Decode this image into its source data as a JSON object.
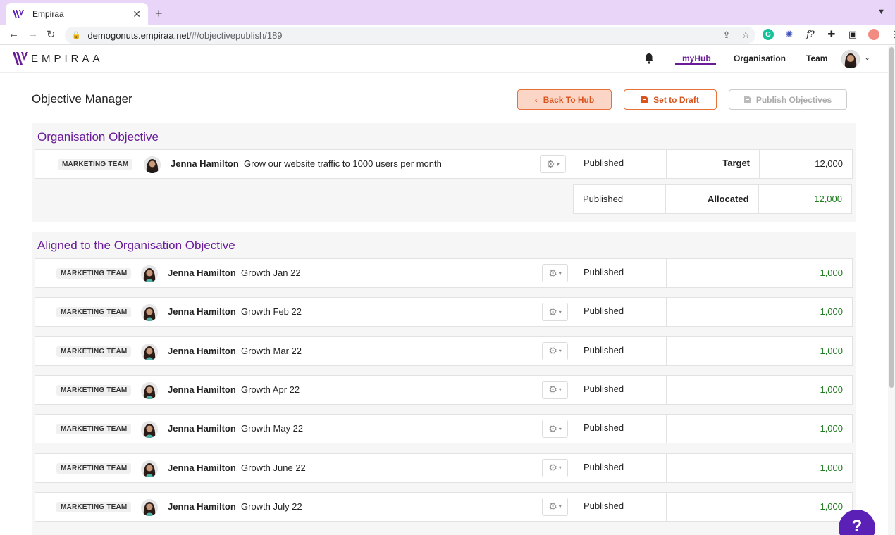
{
  "browser": {
    "tab_title": "Empiraa",
    "url_host": "demogonuts.empiraa.net",
    "url_path": "/#/objectivepublish/189"
  },
  "header": {
    "brand": "EMPIRAA",
    "nav": [
      {
        "label": "myHub",
        "active": true
      },
      {
        "label": "Organisation",
        "active": false
      },
      {
        "label": "Team",
        "active": false
      }
    ]
  },
  "page": {
    "title": "Objective Manager",
    "buttons": {
      "back": "Back To Hub",
      "draft": "Set to Draft",
      "publish": "Publish Objectives"
    }
  },
  "org_section": {
    "title": "Organisation Objective",
    "row": {
      "team": "MARKETING TEAM",
      "owner": "Jenna Hamilton",
      "objective": "Grow our website traffic to 1000 users per month",
      "status": "Published",
      "label": "Target",
      "value": "12,000"
    },
    "allocated": {
      "status": "Published",
      "label": "Allocated",
      "value": "12,000"
    }
  },
  "aligned_section": {
    "title": "Aligned to the Organisation Objective",
    "rows": [
      {
        "team": "MARKETING TEAM",
        "owner": "Jenna Hamilton",
        "objective": "Growth Jan 22",
        "status": "Published",
        "value": "1,000"
      },
      {
        "team": "MARKETING TEAM",
        "owner": "Jenna Hamilton",
        "objective": "Growth Feb 22",
        "status": "Published",
        "value": "1,000"
      },
      {
        "team": "MARKETING TEAM",
        "owner": "Jenna Hamilton",
        "objective": "Growth Mar 22",
        "status": "Published",
        "value": "1,000"
      },
      {
        "team": "MARKETING TEAM",
        "owner": "Jenna Hamilton",
        "objective": "Growth Apr 22",
        "status": "Published",
        "value": "1,000"
      },
      {
        "team": "MARKETING TEAM",
        "owner": "Jenna Hamilton",
        "objective": "Growth May 22",
        "status": "Published",
        "value": "1,000"
      },
      {
        "team": "MARKETING TEAM",
        "owner": "Jenna Hamilton",
        "objective": "Growth June 22",
        "status": "Published",
        "value": "1,000"
      },
      {
        "team": "MARKETING TEAM",
        "owner": "Jenna Hamilton",
        "objective": "Growth July 22",
        "status": "Published",
        "value": "1,000"
      }
    ]
  },
  "help": {
    "label": "?"
  },
  "colors": {
    "brand_purple": "#6a1b9a",
    "accent_orange": "#e8703a",
    "positive_green": "#1e7b1e",
    "help_purple": "#5b21b6"
  }
}
